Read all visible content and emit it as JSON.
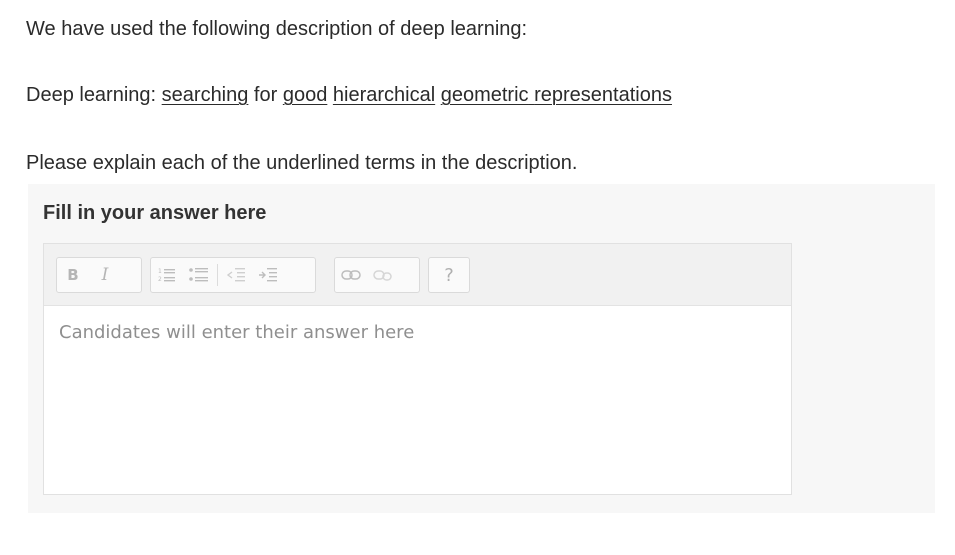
{
  "question": {
    "intro": "We have used the following description of deep learning:",
    "definition": {
      "prefix": "Deep learning: ",
      "terms": [
        "searching",
        "good",
        "hierarchical",
        "geometric",
        "representations"
      ],
      "connector": " for "
    },
    "instruction": "Please explain each of the underlined terms in the description."
  },
  "answer_panel": {
    "title": "Fill in your answer here",
    "placeholder": "Candidates will enter their answer here"
  },
  "toolbar": {
    "bold_label": "B",
    "italic_label": "I",
    "help_label": "?",
    "icons": [
      "bold-icon",
      "italic-icon",
      "numbered-list-icon",
      "bulleted-list-icon",
      "outdent-icon",
      "indent-icon",
      "link-icon",
      "unlink-icon",
      "help-icon"
    ]
  }
}
